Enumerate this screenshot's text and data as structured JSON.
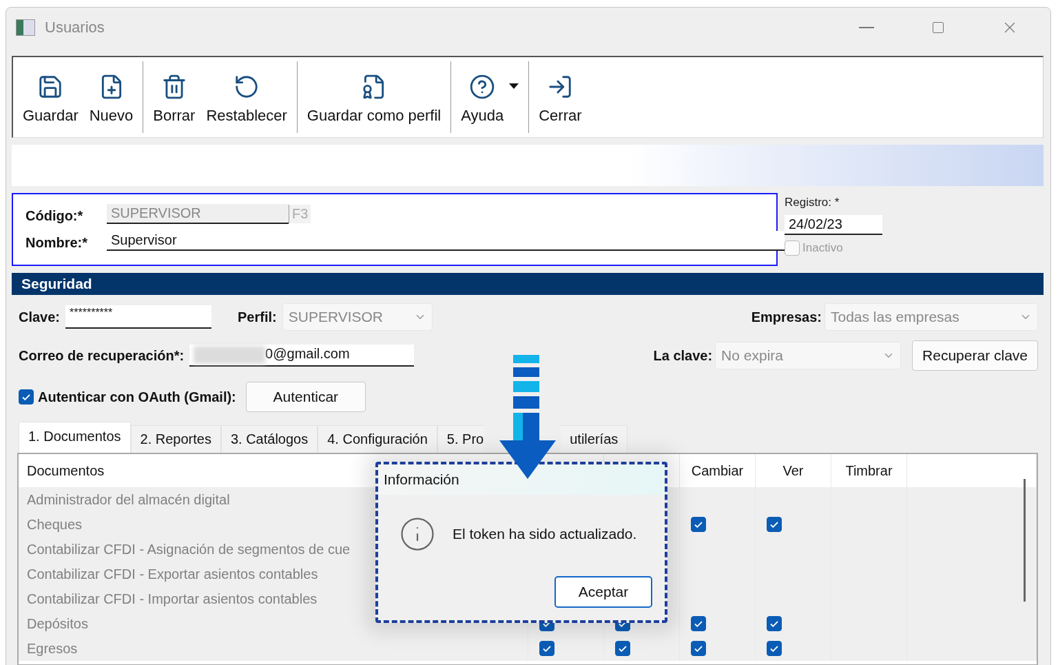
{
  "window": {
    "title": "Usuarios"
  },
  "toolbar": [
    [
      {
        "kind": "save",
        "label": "Guardar"
      },
      {
        "kind": "new",
        "label": "Nuevo"
      }
    ],
    [
      {
        "kind": "delete",
        "label": "Borrar"
      },
      {
        "kind": "reset",
        "label": "Restablecer"
      }
    ],
    [
      {
        "kind": "profile",
        "label": "Guardar como perfil"
      }
    ],
    [
      {
        "kind": "help",
        "label": "Ayuda",
        "has_menu": true
      }
    ],
    [
      {
        "kind": "close",
        "label": "Cerrar"
      }
    ]
  ],
  "identity": {
    "code_label": "Código:*",
    "code_value": "SUPERVISOR",
    "code_key": "F3",
    "name_label": "Nombre:*",
    "name_value": "Supervisor"
  },
  "registro": {
    "label": "Registro: *",
    "date": "24/02/23",
    "inactive_label": "Inactivo",
    "inactive_checked": false
  },
  "security": {
    "title": "Seguridad",
    "password_label": "Clave:",
    "password_value": "**********",
    "profile_label": "Perfil:",
    "profile_value": "SUPERVISOR",
    "companies_label": "Empresas:",
    "companies_value": "Todas las empresas",
    "email_label": "Correo de recuperación*:",
    "email_value": "0@gmail.com",
    "expiry_label": "La clave:",
    "expiry_value": "No expira",
    "recover_button": "Recuperar clave",
    "oauth_label": "Autenticar con OAuth (Gmail):",
    "oauth_checked": true,
    "oauth_button": "Autenticar"
  },
  "tabs": [
    {
      "label": "1. Documentos",
      "selected": true
    },
    {
      "label": "2. Reportes",
      "selected": false
    },
    {
      "label": "3. Catálogos",
      "selected": false
    },
    {
      "label": "4. Configuración",
      "selected": false
    },
    {
      "label": "5. Pro",
      "selected": false,
      "kind": "cut"
    },
    {
      "label": "utilerías",
      "selected": false,
      "kind": "continued"
    }
  ],
  "table": {
    "headers": {
      "documents": "Documentos",
      "cambiar": "Cambiar",
      "ver": "Ver",
      "timbrar": "Timbrar"
    },
    "rows": [
      {
        "name": "Administrador del almacén digital",
        "checks": {
          "cambiar": false,
          "ver": false,
          "timbrar": false
        }
      },
      {
        "name": "Cheques",
        "checks": {
          "cambiar": true,
          "ver": true,
          "timbrar": false
        }
      },
      {
        "name": "Contabilizar CFDI - Asignación de segmentos de cue",
        "checks": {
          "cambiar": false,
          "ver": false,
          "timbrar": false
        }
      },
      {
        "name": "Contabilizar CFDI - Exportar asientos contables",
        "checks": {
          "cambiar": false,
          "ver": false,
          "timbrar": false
        }
      },
      {
        "name": "Contabilizar CFDI - Importar asientos contables",
        "checks": {
          "cambiar": false,
          "ver": false,
          "timbrar": false
        }
      },
      {
        "name": "Depósitos",
        "checks": {
          "column_2": false,
          "column_3": true,
          "column_4": true,
          "cambiar": true,
          "ver": true,
          "timbrar": false
        }
      },
      {
        "name": "Egresos",
        "checks": {
          "column_2": false,
          "column_3": true,
          "column_4": true,
          "cambiar": true,
          "ver": true,
          "timbrar": false
        }
      }
    ]
  },
  "dialog": {
    "title": "Información",
    "message": "El token ha sido actualizado.",
    "button": "Aceptar"
  }
}
